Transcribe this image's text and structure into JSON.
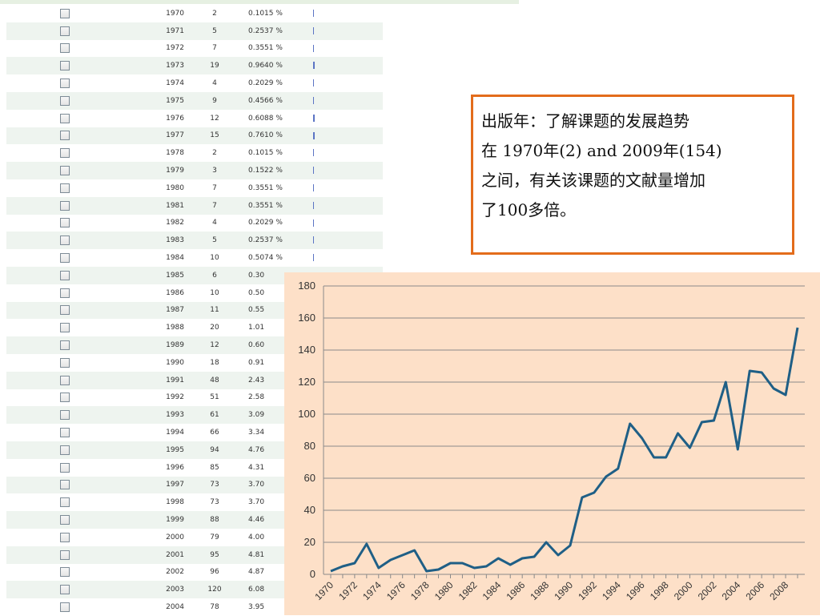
{
  "table": {
    "rows": [
      {
        "year": "1970",
        "count": "2",
        "pct": "0.1015 %"
      },
      {
        "year": "1971",
        "count": "5",
        "pct": "0.2537 %"
      },
      {
        "year": "1972",
        "count": "7",
        "pct": "0.3551 %"
      },
      {
        "year": "1973",
        "count": "19",
        "pct": "0.9640 %"
      },
      {
        "year": "1974",
        "count": "4",
        "pct": "0.2029 %"
      },
      {
        "year": "1975",
        "count": "9",
        "pct": "0.4566 %"
      },
      {
        "year": "1976",
        "count": "12",
        "pct": "0.6088 %"
      },
      {
        "year": "1977",
        "count": "15",
        "pct": "0.7610 %"
      },
      {
        "year": "1978",
        "count": "2",
        "pct": "0.1015 %"
      },
      {
        "year": "1979",
        "count": "3",
        "pct": "0.1522 %"
      },
      {
        "year": "1980",
        "count": "7",
        "pct": "0.3551 %"
      },
      {
        "year": "1981",
        "count": "7",
        "pct": "0.3551 %"
      },
      {
        "year": "1982",
        "count": "4",
        "pct": "0.2029 %"
      },
      {
        "year": "1983",
        "count": "5",
        "pct": "0.2537 %"
      },
      {
        "year": "1984",
        "count": "10",
        "pct": "0.5074 %"
      },
      {
        "year": "1985",
        "count": "6",
        "pct": "0.30"
      },
      {
        "year": "1986",
        "count": "10",
        "pct": "0.50"
      },
      {
        "year": "1987",
        "count": "11",
        "pct": "0.55"
      },
      {
        "year": "1988",
        "count": "20",
        "pct": "1.01"
      },
      {
        "year": "1989",
        "count": "12",
        "pct": "0.60"
      },
      {
        "year": "1990",
        "count": "18",
        "pct": "0.91"
      },
      {
        "year": "1991",
        "count": "48",
        "pct": "2.43"
      },
      {
        "year": "1992",
        "count": "51",
        "pct": "2.58"
      },
      {
        "year": "1993",
        "count": "61",
        "pct": "3.09"
      },
      {
        "year": "1994",
        "count": "66",
        "pct": "3.34"
      },
      {
        "year": "1995",
        "count": "94",
        "pct": "4.76"
      },
      {
        "year": "1996",
        "count": "85",
        "pct": "4.31"
      },
      {
        "year": "1997",
        "count": "73",
        "pct": "3.70"
      },
      {
        "year": "1998",
        "count": "73",
        "pct": "3.70"
      },
      {
        "year": "1999",
        "count": "88",
        "pct": "4.46"
      },
      {
        "year": "2000",
        "count": "79",
        "pct": "4.00"
      },
      {
        "year": "2001",
        "count": "95",
        "pct": "4.81"
      },
      {
        "year": "2002",
        "count": "96",
        "pct": "4.87"
      },
      {
        "year": "2003",
        "count": "120",
        "pct": "6.08"
      },
      {
        "year": "2004",
        "count": "78",
        "pct": "3.95"
      }
    ]
  },
  "infobox": {
    "line1": "出版年：了解课题的发展趋势",
    "line2": "在 1970年(2) and 2009年(154)",
    "line3": "之间，有关该课题的文献量增加",
    "line4": "了100多倍。"
  },
  "chart_data": {
    "type": "line",
    "x": [
      1970,
      1971,
      1972,
      1973,
      1974,
      1975,
      1976,
      1977,
      1978,
      1979,
      1980,
      1981,
      1982,
      1983,
      1984,
      1985,
      1986,
      1987,
      1988,
      1989,
      1990,
      1991,
      1992,
      1993,
      1994,
      1995,
      1996,
      1997,
      1998,
      1999,
      2000,
      2001,
      2002,
      2003,
      2004,
      2005,
      2006,
      2007,
      2008,
      2009
    ],
    "values": [
      2,
      5,
      7,
      19,
      4,
      9,
      12,
      15,
      2,
      3,
      7,
      7,
      4,
      5,
      10,
      6,
      10,
      11,
      20,
      12,
      18,
      48,
      51,
      61,
      66,
      94,
      85,
      73,
      73,
      88,
      79,
      95,
      96,
      120,
      78,
      127,
      126,
      116,
      112,
      154
    ],
    "x_tick_labels": [
      "1970",
      "1972",
      "1974",
      "1976",
      "1978",
      "1980",
      "1982",
      "1984",
      "1986",
      "1988",
      "1990",
      "1992",
      "1994",
      "1996",
      "1998",
      "2000",
      "2002",
      "2004",
      "2006",
      "2008"
    ],
    "y_tick_labels": [
      "0",
      "20",
      "40",
      "60",
      "80",
      "100",
      "120",
      "140",
      "160",
      "180"
    ],
    "ylim": [
      0,
      180
    ],
    "grid": true,
    "line_color": "#1f5f86",
    "title": "",
    "xlabel": "",
    "ylabel": ""
  }
}
